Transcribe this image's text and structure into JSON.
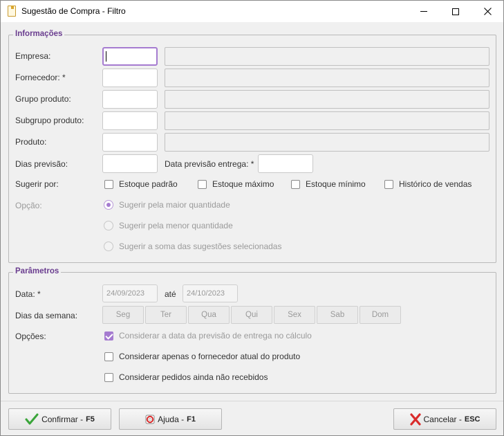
{
  "window": {
    "title": "Sugestão de Compra - Filtro"
  },
  "info": {
    "legend": "Informações",
    "empresa_label": "Empresa:",
    "fornecedor_label": "Fornecedor: *",
    "grupo_label": "Grupo produto:",
    "subgrupo_label": "Subgrupo produto:",
    "produto_label": "Produto:",
    "dias_previsao_label": "Dias previsão:",
    "data_previsao_entrega_label": "Data previsão entrega: *",
    "sugerir_por_label": "Sugerir por:",
    "sugerir_options": [
      "Estoque padrão",
      "Estoque máximo",
      "Estoque mínimo",
      "Histórico de vendas"
    ],
    "opcao_label": "Opção:",
    "opcao_options": [
      "Sugerir pela maior quantidade",
      "Sugerir pela menor quantidade",
      "Sugerir a soma das sugestões selecionadas"
    ],
    "opcao_selected": 0
  },
  "params": {
    "legend": "Parâmetros",
    "data_label": "Data: *",
    "data_inicio": "24/09/2023",
    "ate_label": "até",
    "data_fim": "24/10/2023",
    "dias_semana_label": "Dias da semana:",
    "dias": [
      "Seg",
      "Ter",
      "Qua",
      "Qui",
      "Sex",
      "Sab",
      "Dom"
    ],
    "opcoes_label": "Opções:",
    "opcoes": [
      {
        "label": "Considerar a data da previsão de entrega no cálculo",
        "checked": true
      },
      {
        "label": "Considerar apenas o fornecedor atual do produto",
        "checked": false
      },
      {
        "label": "Considerar pedidos ainda não recebidos",
        "checked": false
      }
    ]
  },
  "footer": {
    "confirmar_label": "Confirmar - ",
    "confirmar_key": "F5",
    "ajuda_label": "Ajuda - ",
    "ajuda_key": "F1",
    "cancelar_label": "Cancelar - ",
    "cancelar_key": "ESC"
  },
  "colors": {
    "accent": "#a57bd0",
    "legend": "#6a3d8f",
    "confirm_icon": "#3aa53a",
    "cancel_icon": "#d92b2b"
  },
  "icons": {
    "app": "document-icon",
    "confirmar": "checkmark-icon",
    "ajuda": "help-icon",
    "cancelar": "x-icon"
  }
}
